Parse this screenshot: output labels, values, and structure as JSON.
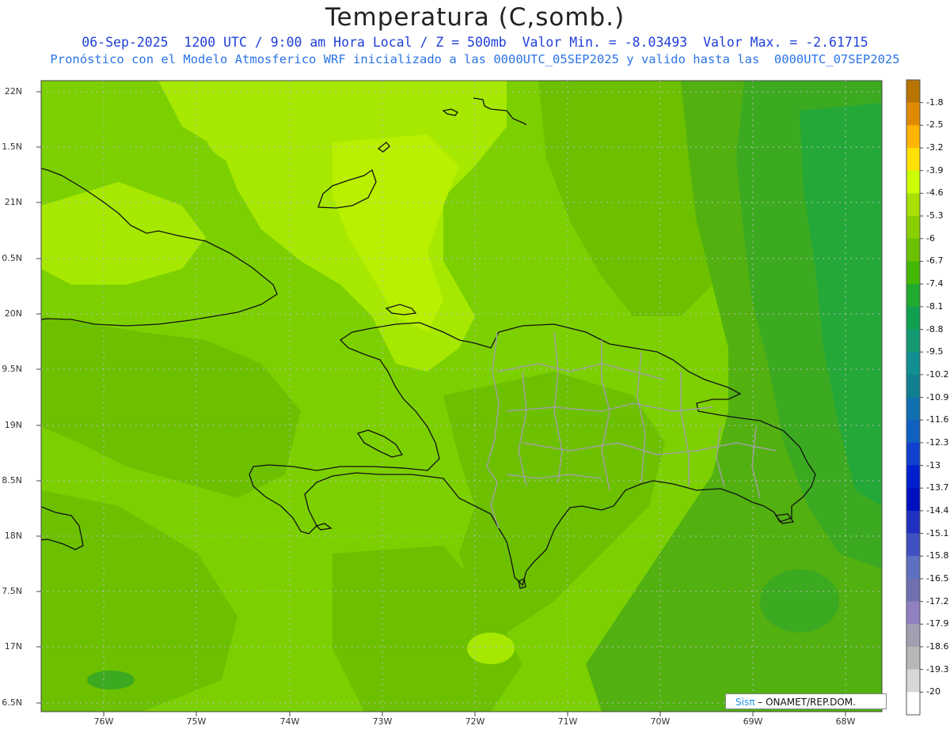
{
  "header": {
    "title": "Temperatura (C,somb.)",
    "line1": "06-Sep-2025  1200 UTC / 9:00 am Hora Local / Z = 500mb  Valor Min. = -8.03493  Valor Max. = -2.61715",
    "line2": "Pronóstico con el Modelo Atmosferico WRF inicializado a las 0000UTC_05SEP2025 y valido hasta las  0000UTC_07SEP2025"
  },
  "axes": {
    "lat_labels": [
      "22N",
      "1.5N",
      "21N",
      "0.5N",
      "20N",
      "9.5N",
      "19N",
      "8.5N",
      "18N",
      "7.5N",
      "17N",
      "6.5N"
    ],
    "lon_labels": [
      "76W",
      "75W",
      "74W",
      "73W",
      "72W",
      "71W",
      "70W",
      "69W",
      "68W"
    ]
  },
  "colorbar": {
    "labels": [
      "-1.8",
      "-2.5",
      "-3.2",
      "-3.9",
      "-4.6",
      "-5.3",
      "-6",
      "-6.7",
      "-7.4",
      "-8.1",
      "-8.8",
      "-9.5",
      "-10.2",
      "-10.9",
      "-11.6",
      "-12.3",
      "-13",
      "-13.7",
      "-14.4",
      "-15.1",
      "-15.8",
      "-16.5",
      "-17.2",
      "-17.9",
      "-18.6",
      "-19.3",
      "-20"
    ],
    "colors": [
      "#b87400",
      "#e08a00",
      "#ffb400",
      "#ffe000",
      "#ccff00",
      "#a8e000",
      "#8ad000",
      "#6cc000",
      "#44b800",
      "#20aa30",
      "#10a050",
      "#139a70",
      "#109090",
      "#108090",
      "#1070b0",
      "#1060c0",
      "#1040d0",
      "#0020d0",
      "#0010c0",
      "#2030c0",
      "#4050c0",
      "#6070c0",
      "#7070b0",
      "#9080c0",
      "#a0a0b0",
      "#b8b8b8",
      "#d8d8d8",
      "#ffffff"
    ]
  },
  "field_colors": {
    "base": "#7cd000",
    "light": "#a6e800",
    "lighter": "#b8f000",
    "medium": "#6cc000",
    "dark": "#52b010",
    "darker": "#3caa20",
    "deep": "#24a838"
  },
  "credit": {
    "brand": "Sisπ",
    "text": "– ONAMET/REP.DOM."
  }
}
